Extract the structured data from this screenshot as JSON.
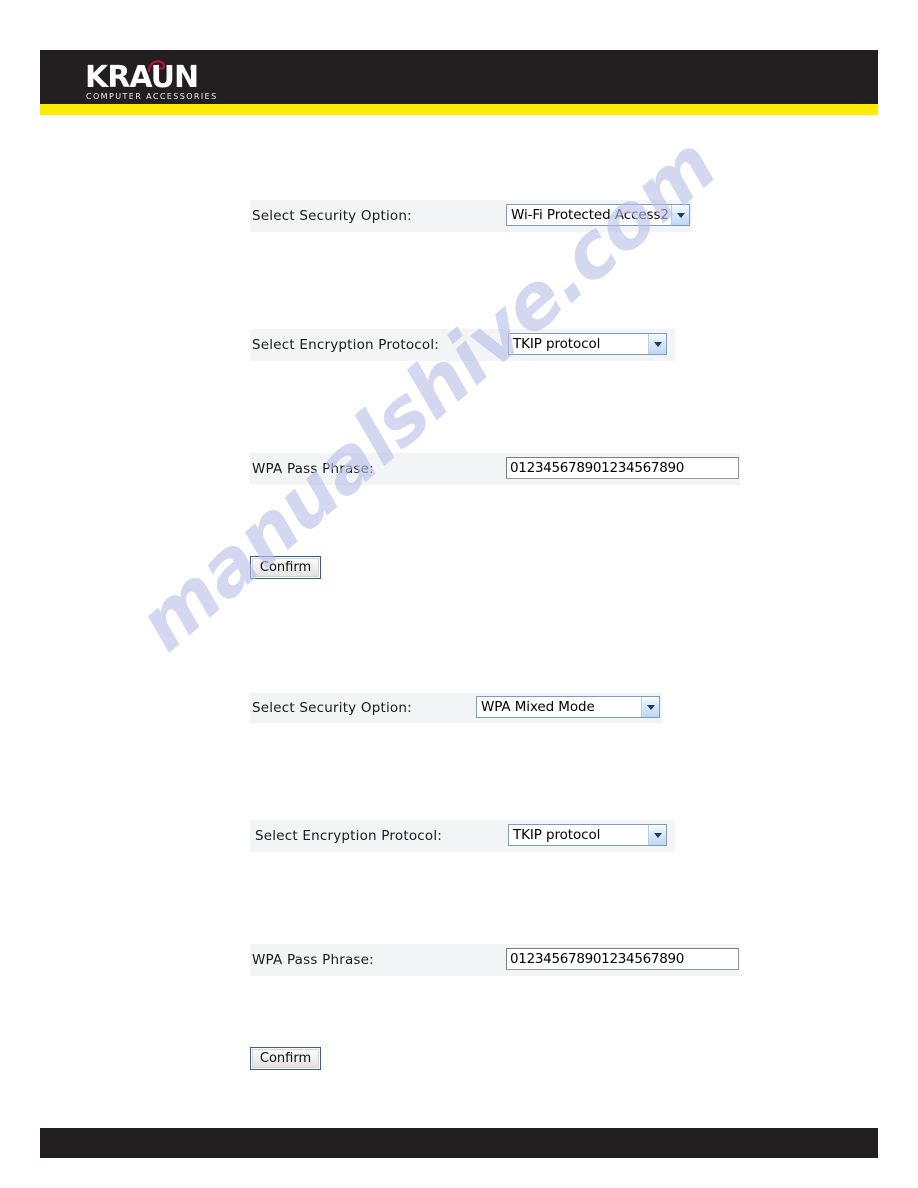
{
  "brand": {
    "name": "KRAUN",
    "registered_mark": "®",
    "tagline": "COMPUTER ACCESSORIES",
    "bar_color": "#231f20",
    "stripe_color": "#ffed00",
    "swirl_color": "#c4122f"
  },
  "watermark": {
    "text": "manualshive.com",
    "color": "#b9c0e8"
  },
  "screenshots": [
    {
      "id": "wpa2-settings",
      "rows": [
        {
          "label": "Select Security Option:",
          "control": "select",
          "value": "Wi-Fi Protected Access2"
        },
        {
          "label": "Select Encryption Protocol:",
          "control": "select",
          "value": "TKIP protocol"
        },
        {
          "label": "WPA Pass Phrase:",
          "control": "text",
          "value": "012345678901234567890"
        }
      ],
      "button": "Confirm"
    },
    {
      "id": "wpa-mixed-mode-settings",
      "rows": [
        {
          "label": "Select Security Option:",
          "control": "select",
          "value": "WPA Mixed Mode"
        },
        {
          "label": "Select Encryption Protocol:",
          "control": "select",
          "value": "TKIP protocol"
        },
        {
          "label": "WPA Pass Phrase:",
          "control": "text",
          "value": "012345678901234567890"
        }
      ],
      "button": "Confirm"
    }
  ]
}
